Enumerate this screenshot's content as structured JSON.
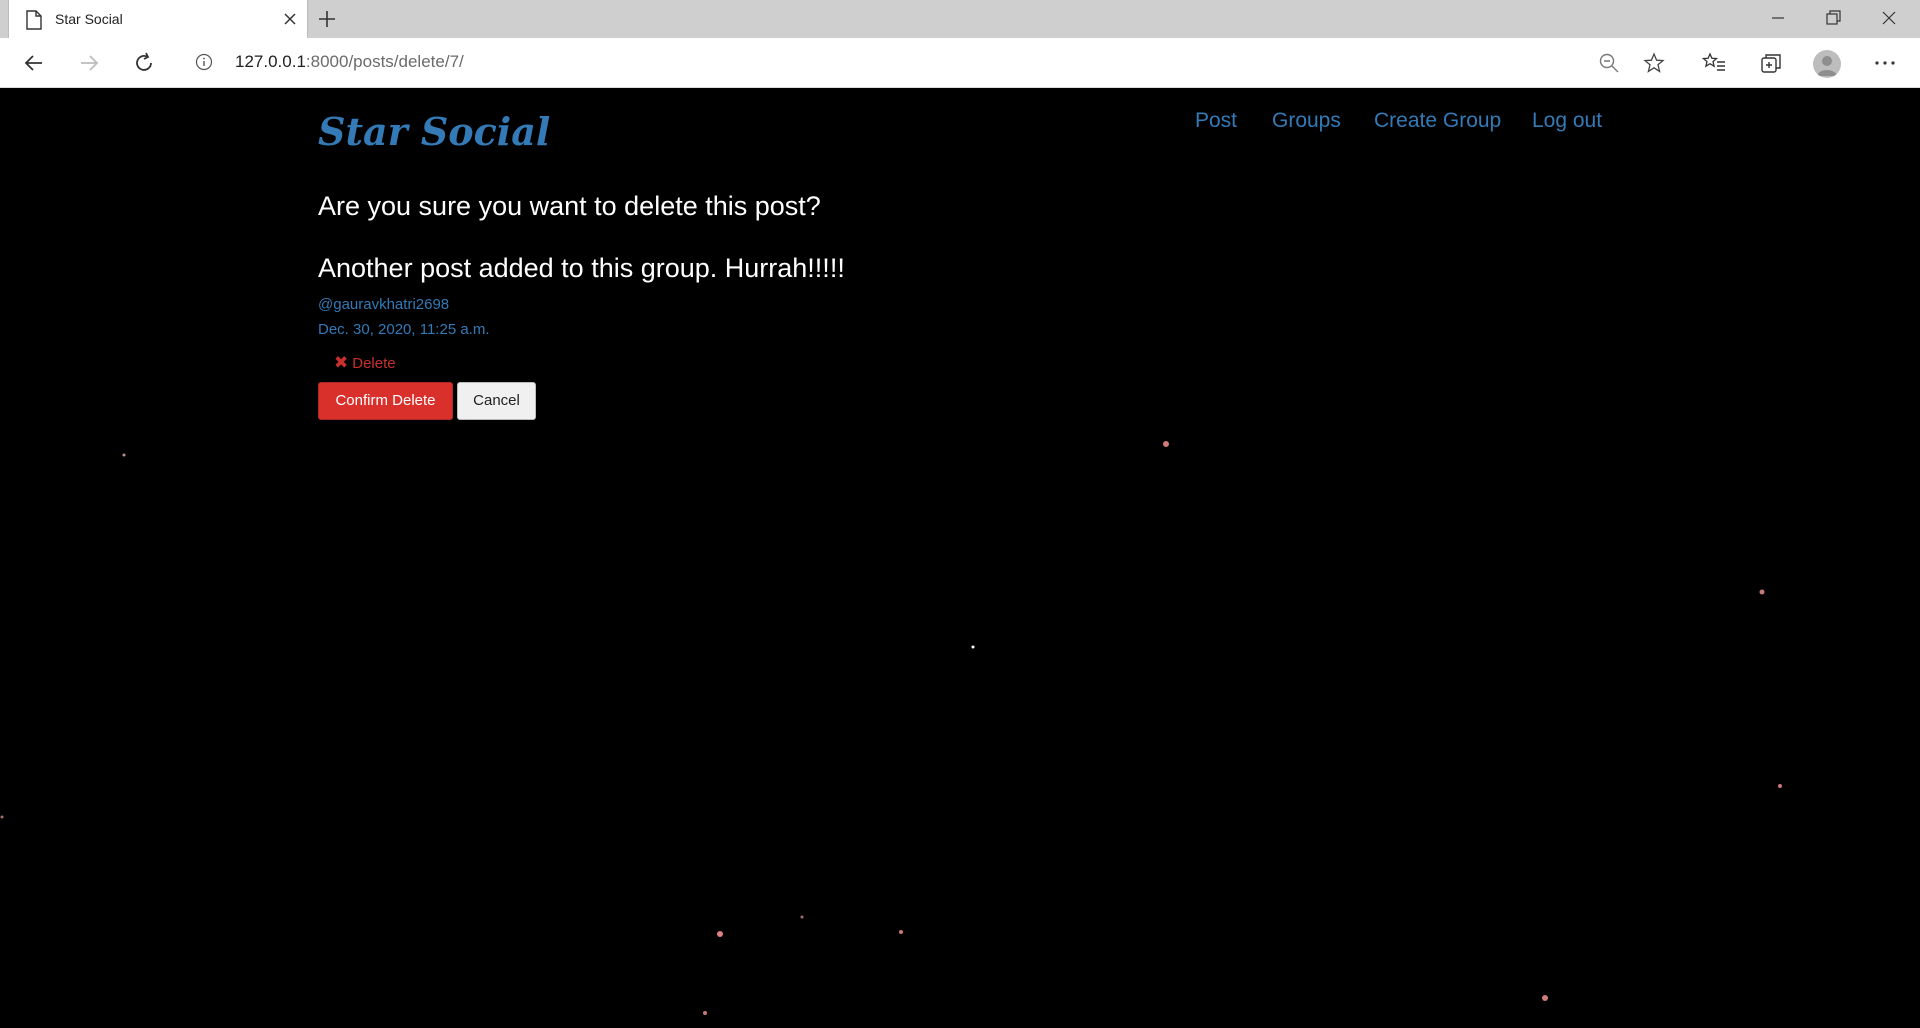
{
  "browser": {
    "tab_title": "Star Social",
    "url_host": "127.0.0.1",
    "url_rest": ":8000/posts/delete/7/"
  },
  "site": {
    "brand": "Star Social",
    "nav": {
      "post": "Post",
      "groups": "Groups",
      "create_group": "Create Group",
      "logout": "Log out"
    }
  },
  "main": {
    "question": "Are you sure you want to delete this post?",
    "post_text": "Another post added to this group. Hurrah!!!!!",
    "username": "@gauravkhatri2698",
    "timestamp": "Dec. 30, 2020, 11:25 a.m.",
    "delete_label": "Delete",
    "delete_glyph": "✖",
    "confirm_label": "Confirm Delete",
    "cancel_label": "Cancel"
  },
  "colors": {
    "link": "#337ab7",
    "danger": "#d9302c",
    "background": "#000000"
  }
}
